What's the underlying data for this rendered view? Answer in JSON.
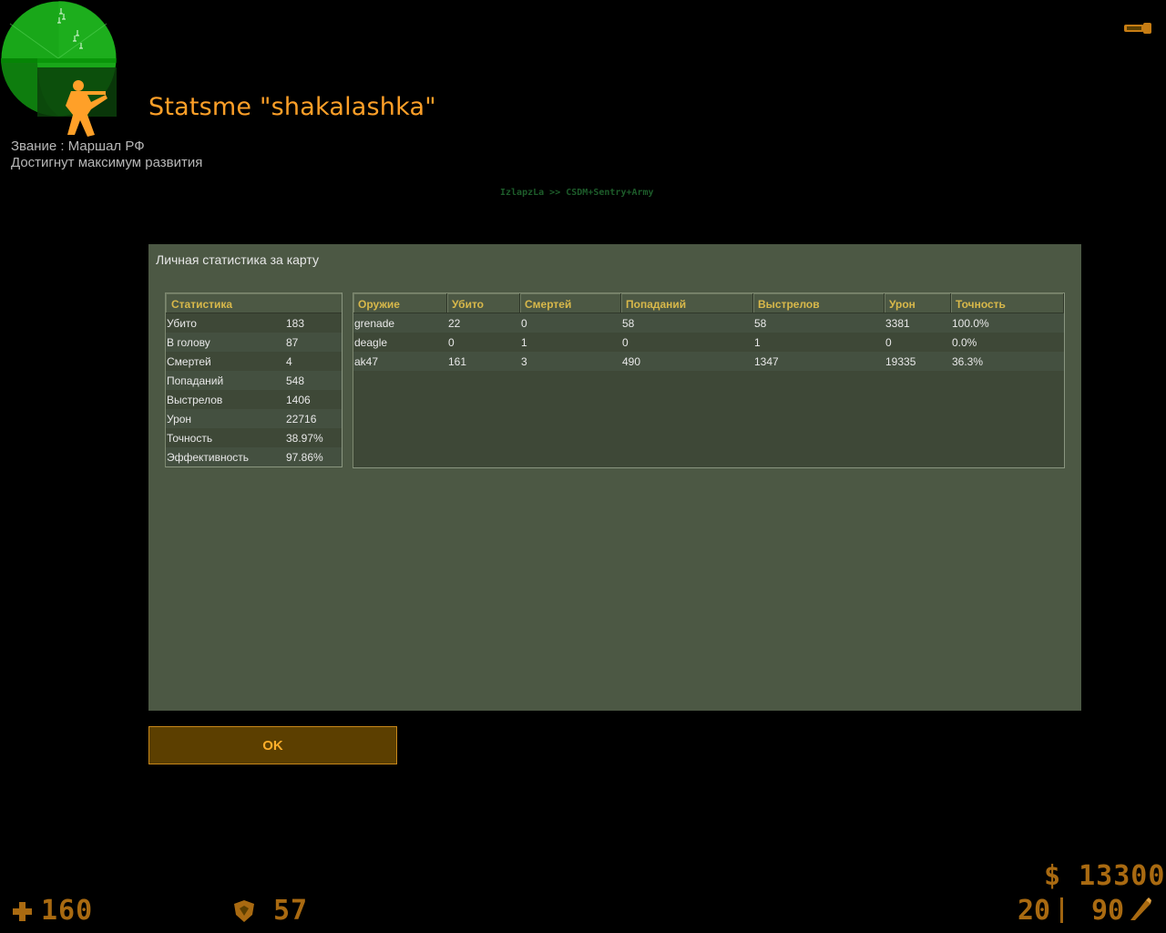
{
  "header": {
    "title": "Statsme \"shakalashka\"",
    "rank_line": "Звание : Маршал РФ",
    "rank_status": "Достигнут максимум развития",
    "server_name": "IzlapzLa >> CSDM+Sentry+Army"
  },
  "panel": {
    "title": "Личная статистика за карту",
    "stats": {
      "header": "Статистика",
      "rows": [
        {
          "label": "Убито",
          "value": "183"
        },
        {
          "label": "В голову",
          "value": "87"
        },
        {
          "label": "Смертей",
          "value": "4"
        },
        {
          "label": "Попаданий",
          "value": "548"
        },
        {
          "label": "Выстрелов",
          "value": "1406"
        },
        {
          "label": "Урон",
          "value": "22716"
        },
        {
          "label": "Точность",
          "value": "38.97%"
        },
        {
          "label": "Эффективность",
          "value": "97.86%"
        }
      ]
    },
    "weapons": {
      "columns": [
        "Оружие",
        "Убито",
        "Смертей",
        "Попаданий",
        "Выстрелов",
        "Урон",
        "Точность"
      ],
      "rows": [
        [
          "grenade",
          "22",
          "0",
          "58",
          "58",
          "3381",
          "100.0%"
        ],
        [
          "deagle",
          "0",
          "1",
          "0",
          "1",
          "0",
          "0.0%"
        ],
        [
          "ak47",
          "161",
          "3",
          "490",
          "1347",
          "19335",
          "36.3%"
        ]
      ]
    }
  },
  "ok_button": {
    "label": "OK"
  },
  "hud": {
    "health": "160",
    "armor": "57",
    "money": "$ 13300",
    "clip": "20",
    "reserve": "90",
    "icons": [
      "health-cross-icon",
      "armor-shield-icon",
      "ammo-icon",
      "flashlight-icon",
      "radar"
    ]
  },
  "colors": {
    "accent": "#ffa028",
    "panel_bg": "#4c5844",
    "header_text": "#d8b84a",
    "hud": "#c77d14",
    "radar": "#1ca71c"
  }
}
